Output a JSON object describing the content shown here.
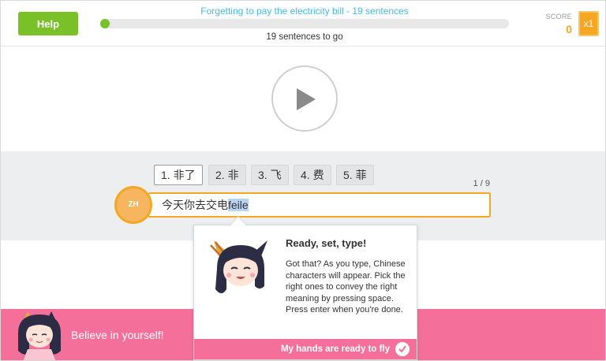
{
  "header": {
    "help_label": "Help",
    "lesson_title": "Forgetting to pay the electricity bill - 19 sentences",
    "progress_fraction": 0.0,
    "sentences_left": "19 sentences to go",
    "score_label": "SCORE",
    "score_value": "0",
    "multiplier": "x1"
  },
  "player": {
    "play_icon": "play-icon"
  },
  "candidates": [
    {
      "label": "1. 非了",
      "active": true
    },
    {
      "label": "2. 非",
      "active": false
    },
    {
      "label": "3. 飞",
      "active": false
    },
    {
      "label": "4. 费",
      "active": false
    },
    {
      "label": "5. 菲",
      "active": false
    }
  ],
  "input": {
    "counter": "1 / 9",
    "typed_text": "今天你去交电",
    "composing_text": "feile",
    "language_badge": "ZH"
  },
  "tooltip": {
    "title": "Ready, set, type!",
    "body": "Got that? As you type, Chinese characters will appear. Pick the right ones to convey the right meaning by pressing space. Press enter when you're done.",
    "action_label": "My hands are ready to fly"
  },
  "banner": {
    "text": "Believe in yourself!"
  },
  "colors": {
    "accent_green": "#7ac029",
    "accent_orange": "#f5a623",
    "accent_pink": "#f4709a",
    "title_blue": "#49b9e0"
  }
}
